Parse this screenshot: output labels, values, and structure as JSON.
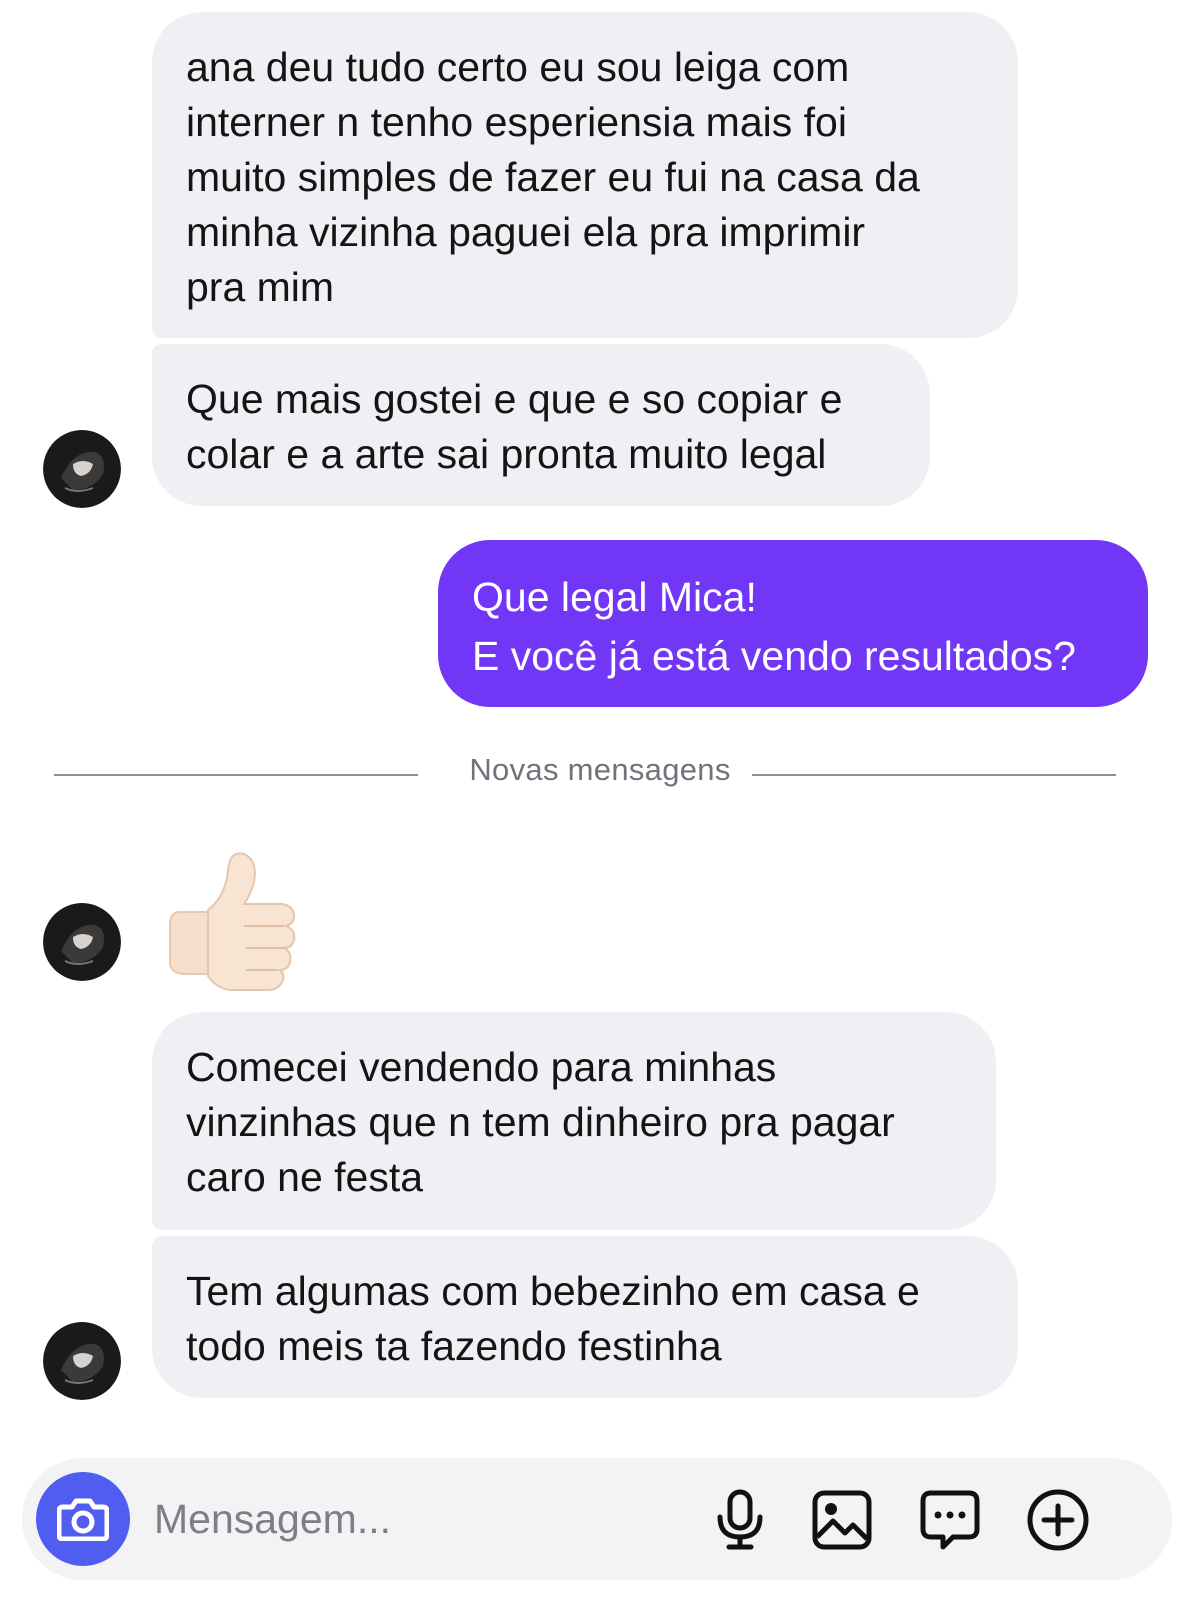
{
  "chat": {
    "messages": [
      {
        "from": "contact",
        "text": "ana deu tudo certo eu sou leiga com\ninterner n tenho esperiensia mais foi\nmuito simples de fazer eu fui na casa da\nminha vizinha paguei ela pra imprimir\npra mim"
      },
      {
        "from": "contact",
        "text": "Que mais gostei e que e so copiar e\ncolar e a arte sai pronta muito legal"
      },
      {
        "from": "me",
        "text": "Que legal Mica!\nE você já está vendo resultados?"
      },
      {
        "from": "contact",
        "emoji": "thumbs-up"
      },
      {
        "from": "contact",
        "text": "Comecei vendendo para minhas\nvinzinhas que n tem dinheiro pra pagar\ncaro ne festa"
      },
      {
        "from": "contact",
        "text": "Tem algumas com bebezinho em casa e\ntodo meis ta fazendo festinha"
      }
    ],
    "new_messages_divider": "Novas mensagens"
  },
  "composer": {
    "placeholder": "Mensagem...",
    "icons": [
      "camera-icon",
      "microphone-icon",
      "image-icon",
      "sticker-icon",
      "plus-circle-icon"
    ]
  },
  "colors": {
    "incoming_bubble": "#eff0f4",
    "outgoing_bubble": "#7237f6",
    "camera_button": "#4f5ef0",
    "composer_background": "#f3f3f5"
  }
}
